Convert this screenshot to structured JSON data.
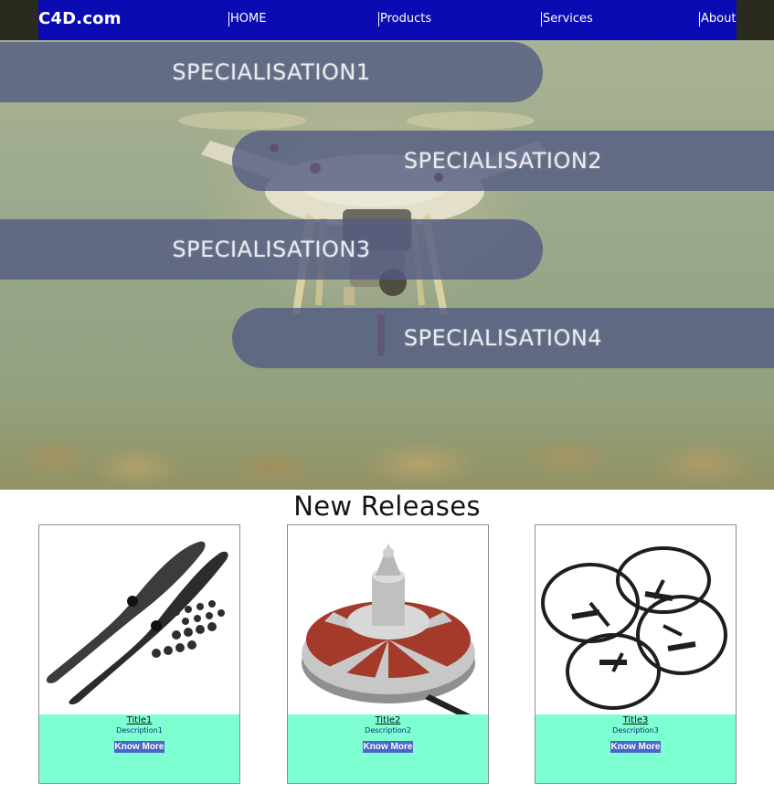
{
  "header": {
    "brand": "C4D.com",
    "nav": [
      "HOME",
      "Products",
      "Services",
      "About"
    ]
  },
  "hero": {
    "specialisations": [
      "SPECIALISATION1",
      "SPECIALISATION2",
      "SPECIALISATION3",
      "SPECIALISATION4"
    ]
  },
  "releases": {
    "heading": "New Releases",
    "cards": [
      {
        "title": "Title1",
        "description": "Description1",
        "button": "Know More",
        "image_icon": "propeller-icon"
      },
      {
        "title": "Title2",
        "description": "Description2",
        "button": "Know More",
        "image_icon": "motor-icon"
      },
      {
        "title": "Title3",
        "description": "Description3",
        "button": "Know More",
        "image_icon": "prop-guard-icon"
      }
    ]
  },
  "colors": {
    "navbar": "#0b0bb3",
    "band": "#525a82",
    "card_body": "#7dffd1",
    "button": "#4a66c7"
  }
}
